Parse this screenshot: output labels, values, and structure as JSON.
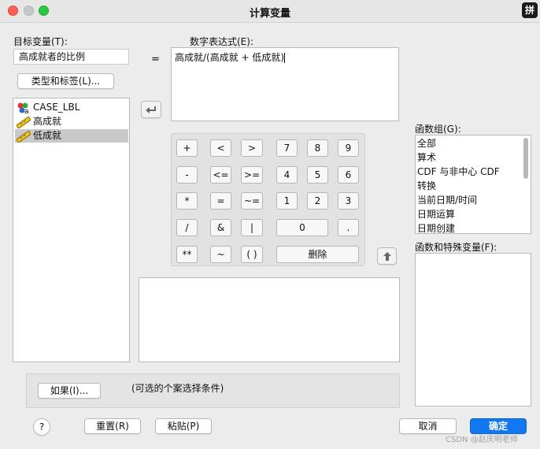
{
  "window": {
    "title": "计算变量",
    "ime_badge": "拼"
  },
  "target": {
    "label": "目标变量(T):",
    "value": "高成就者的比例"
  },
  "equals": "=",
  "expression": {
    "label": "数字表达式(E):",
    "value": "高成就/(高成就 + 低成就)"
  },
  "type_label_button": "类型和标签(L)...",
  "variables": [
    {
      "name": "CASE_LBL",
      "icon": "nominal-abc-icon",
      "selected": false
    },
    {
      "name": "高成就",
      "icon": "scale-ruler-icon",
      "selected": false
    },
    {
      "name": "低成就",
      "icon": "scale-ruler-icon",
      "selected": true
    }
  ],
  "keypad": {
    "row1": [
      "+",
      "<",
      ">",
      "7",
      "8",
      "9"
    ],
    "row2": [
      "-",
      "<=",
      ">=",
      "4",
      "5",
      "6"
    ],
    "row3": [
      "*",
      "=",
      "~=",
      "1",
      "2",
      "3"
    ],
    "row4": [
      "/",
      "&",
      "|",
      "0",
      "."
    ],
    "row5": [
      "**",
      "~",
      "( )",
      "删除"
    ]
  },
  "function_group": {
    "label": "函数组(G):",
    "items": [
      "全部",
      "算术",
      "CDF 与非中心 CDF",
      "转换",
      "当前日期/时间",
      "日期运算",
      "日期创建"
    ]
  },
  "functions_label": "函数和特殊变量(F):",
  "if_button": "如果(I)...",
  "if_hint": "(可选的个案选择条件)",
  "buttons": {
    "help": "?",
    "reset": "重置(R)",
    "paste": "粘贴(P)",
    "cancel": "取消",
    "ok": "确定"
  },
  "watermark": "CSDN @赵庆明老师",
  "colors": {
    "primary": "#1278f0",
    "selection": "#c9c9c9"
  }
}
